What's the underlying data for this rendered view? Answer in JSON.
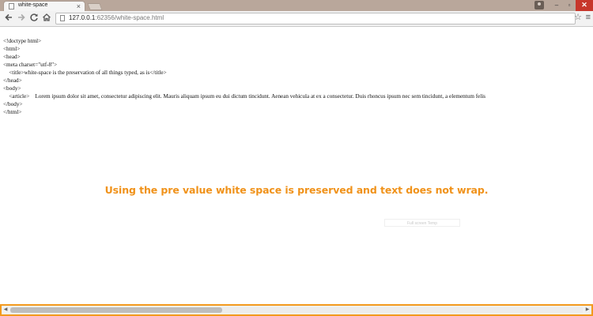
{
  "browser": {
    "tab_title": "white-space",
    "tab_close": "×",
    "url_host": "127.0.0.1",
    "url_path": ":62356/white-space.html",
    "window_controls": {
      "minimize": "–",
      "maximize": "▫",
      "close": "✕"
    },
    "icons": {
      "back": "back-arrow-icon",
      "forward": "forward-arrow-icon",
      "reload": "reload-icon",
      "home": "home-icon",
      "bookmark": "star-icon",
      "menu": "hamburger-menu-icon",
      "user": "user-icon"
    }
  },
  "page": {
    "source_lines": [
      "<!doctype html>",
      "<html>",
      "<head>",
      "<meta charset=\"utf-8\">",
      "    <title>white-space is the preservation of all things typed, as is</title>",
      "</head>",
      "<body>",
      "    <article>    Lorem ipsum dolor sit amet, consectetur adipiscing elit. Mauris aliquam ipsum eu dui dictum tincidunt. Aenean vehicula at ex a consectetur. Duis rhoncus ipsum nec sem tincidunt, a elementum felis",
      "</body>",
      "</html>"
    ],
    "caption": "Using the pre value white space is preserved and text does not wrap.",
    "fullscreen_hint": "Full screen Temp"
  },
  "colors": {
    "accent": "#f0921a",
    "scroll_border": "#f39a1e",
    "titlebar": "#b9a79b",
    "close_button": "#c7362b"
  }
}
